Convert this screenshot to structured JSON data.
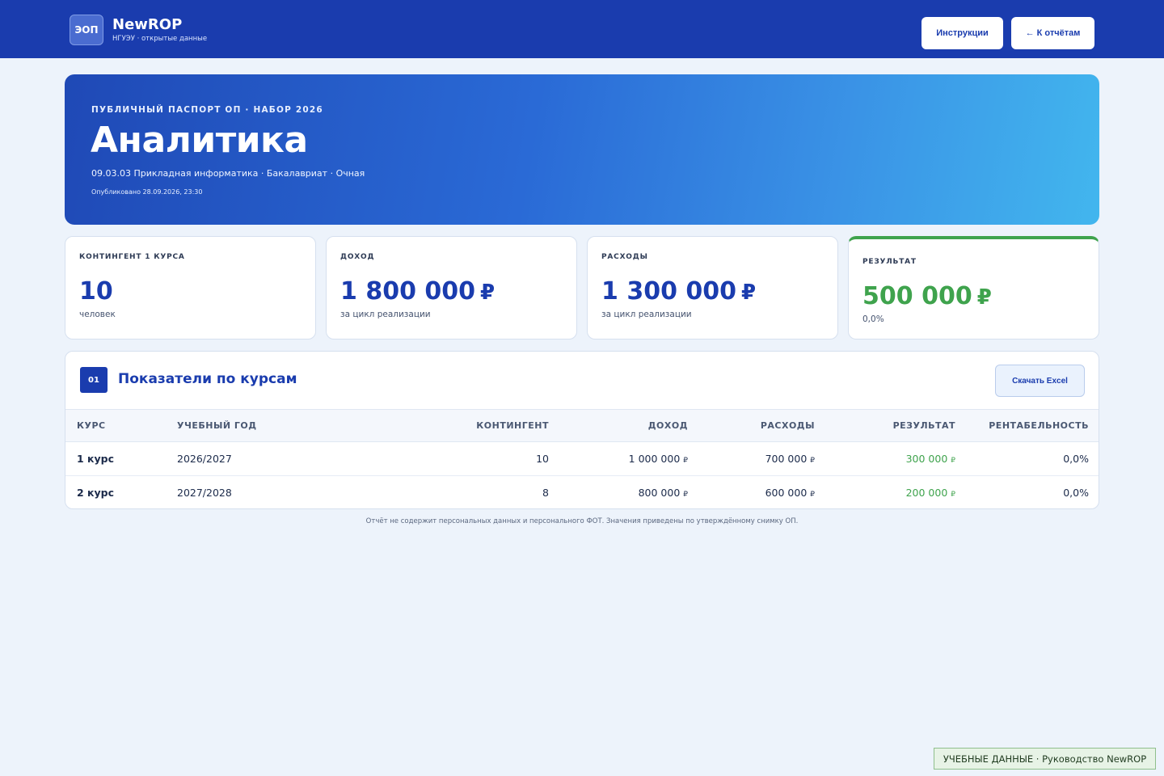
{
  "header": {
    "logo_text": "ЭОП",
    "brand_name": "NewROP",
    "brand_sub": "НГУЭУ · открытые данные",
    "instructions_label": "Инструкции",
    "back_label": "← К отчётам"
  },
  "hero": {
    "kicker": "ПУБЛИЧНЫЙ ПАСПОРТ ОП · НАБОР 2026",
    "title": "Аналитика",
    "meta": "09.03.03 Прикладная информатика · Бакалавриат · Очная",
    "published": "Опубликовано 28.09.2026, 23:30"
  },
  "stats": {
    "currency": "₽",
    "contingent": {
      "label": "КОНТИНГЕНТ 1 КУРСА",
      "value": "10",
      "sub": "человек"
    },
    "income": {
      "label": "ДОХОД",
      "value": "1 800 000",
      "sub": "за цикл реализации"
    },
    "expenses": {
      "label": "РАСХОДЫ",
      "value": "1 300 000",
      "sub": "за цикл реализации"
    },
    "result": {
      "label": "РЕЗУЛЬТАТ",
      "value": "500 000",
      "sub": "0,0%"
    }
  },
  "section": {
    "number": "01",
    "title": "Показатели по курсам",
    "download_label": "Скачать Excel",
    "columns": [
      "КУРС",
      "УЧЕБНЫЙ ГОД",
      "КОНТИНГЕНТ",
      "ДОХОД",
      "РАСХОДЫ",
      "РЕЗУЛЬТАТ",
      "РЕНТАБЕЛЬНОСТЬ"
    ],
    "rows": [
      {
        "course": "1 курс",
        "year": "2026/2027",
        "contingent": "10",
        "income": "1 000 000",
        "expenses": "700 000",
        "result": "300 000",
        "margin": "0,0%"
      },
      {
        "course": "2 курс",
        "year": "2027/2028",
        "contingent": "8",
        "income": "800 000",
        "expenses": "600 000",
        "result": "200 000",
        "margin": "0,0%"
      }
    ]
  },
  "footnote": "Отчёт не содержит персональных данных и персонального ФОТ. Значения приведены по утверждённому снимку ОП.",
  "badge": "УЧЕБНЫЕ ДАННЫЕ · Руководство NewROP"
}
